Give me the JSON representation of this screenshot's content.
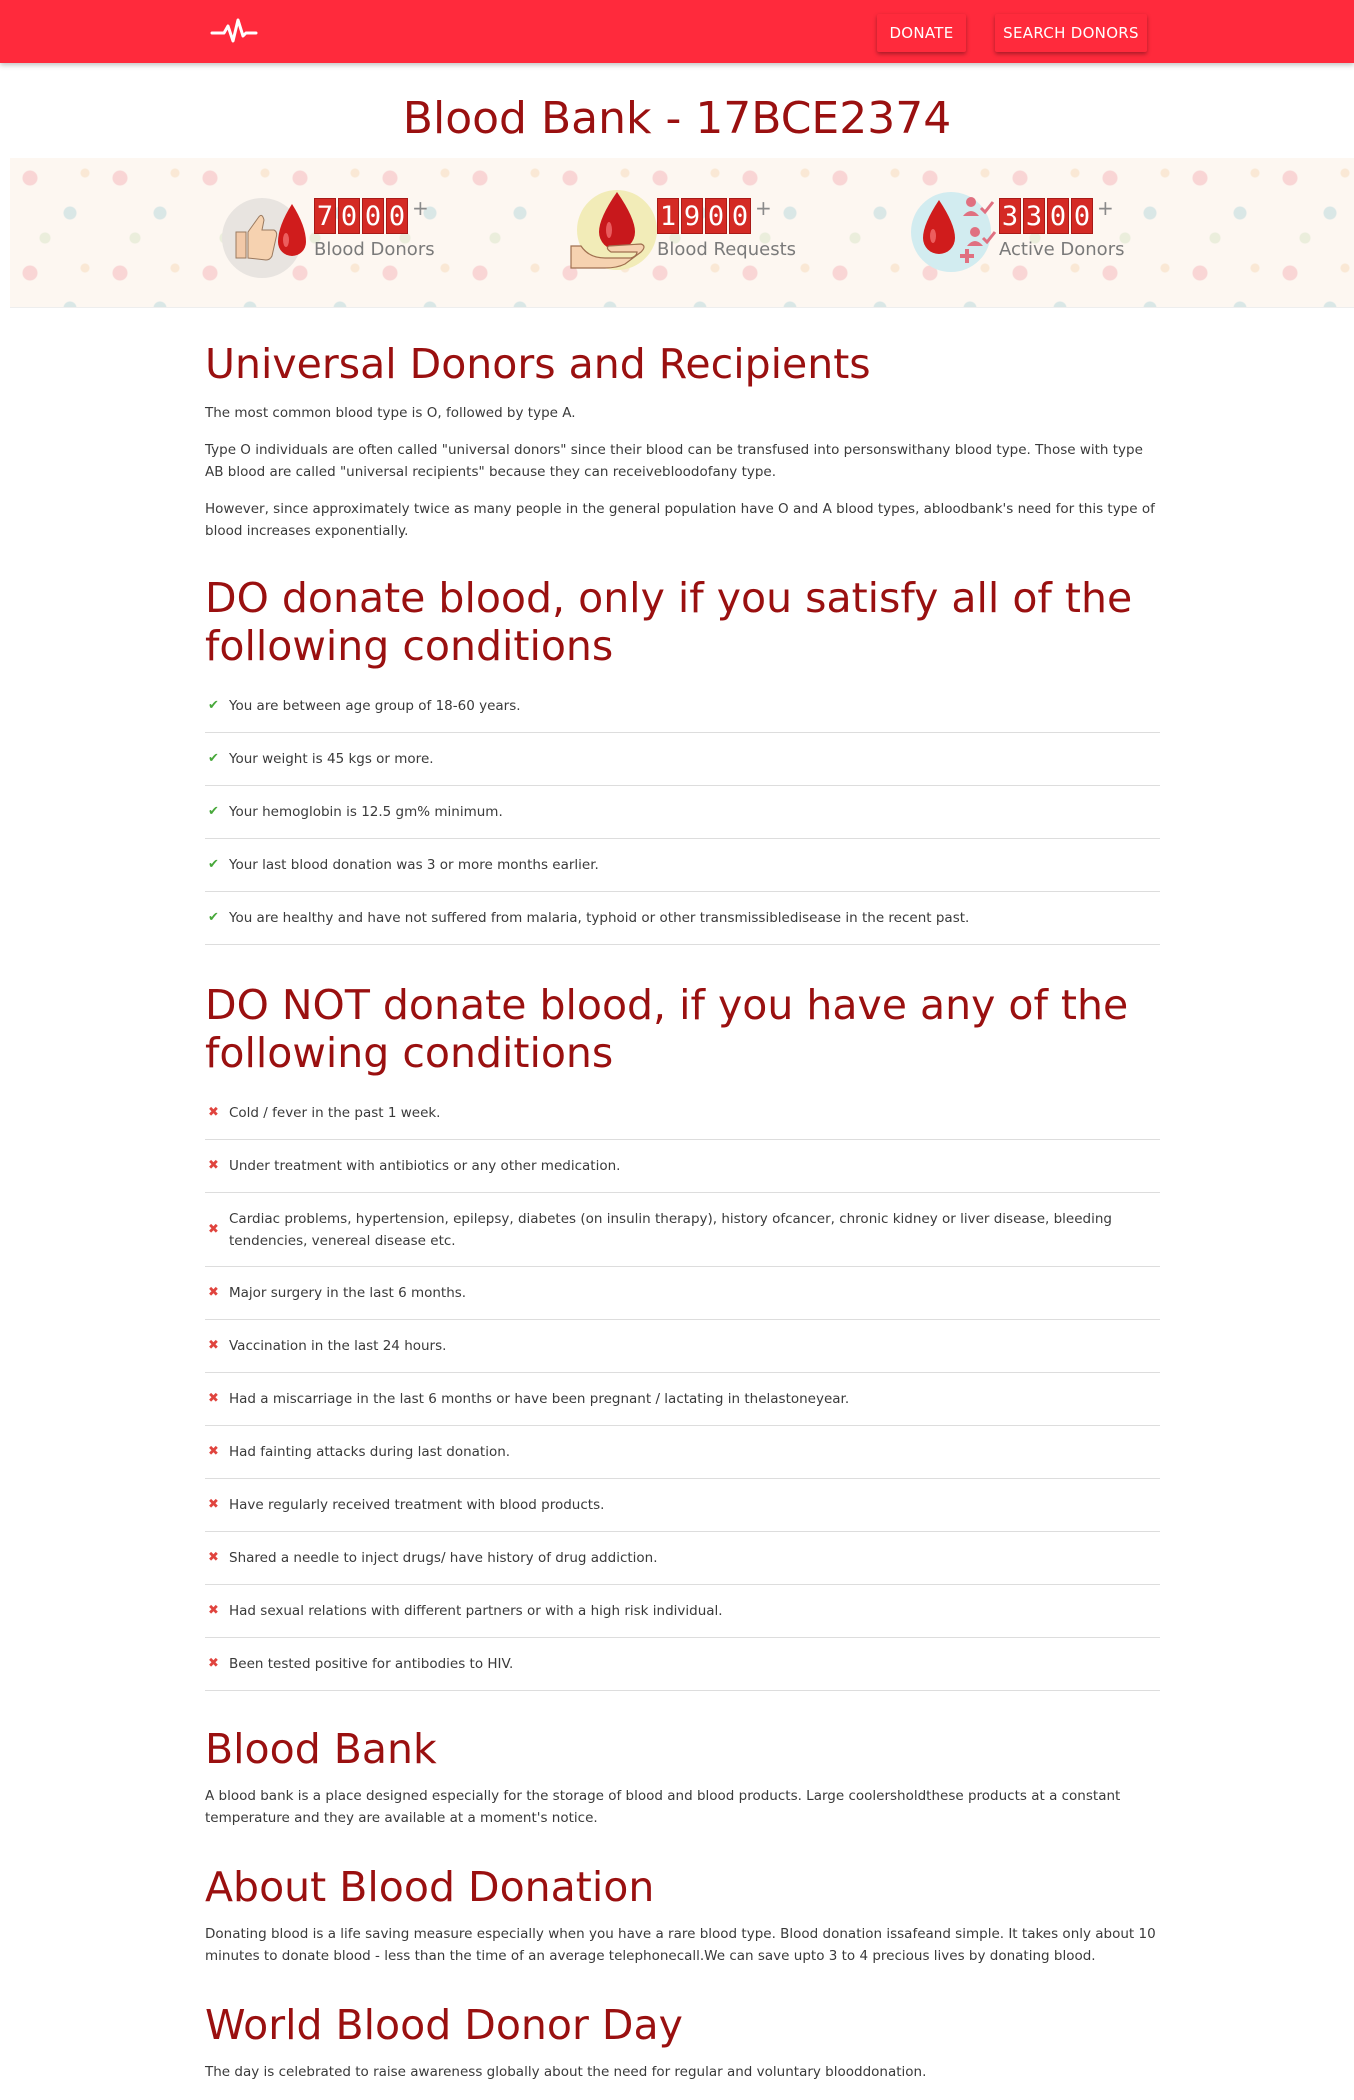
{
  "nav": {
    "donate_label": "DONATE",
    "search_label": "SEARCH DONORS"
  },
  "page_title": "Blood Bank - 17BCE2374",
  "stats": [
    {
      "digits": [
        "7",
        "0",
        "0",
        "0"
      ],
      "plus": "+",
      "label": "Blood Donors",
      "icon": "thumbs-up-blood-drop-icon"
    },
    {
      "digits": [
        "1",
        "9",
        "0",
        "0"
      ],
      "plus": "+",
      "label": "Blood Requests",
      "icon": "hand-holding-blood-drop-icon"
    },
    {
      "digits": [
        "3",
        "3",
        "0",
        "0"
      ],
      "plus": "+",
      "label": "Active Donors",
      "icon": "blood-drop-users-icon"
    }
  ],
  "universal": {
    "heading": "Universal Donors and Recipients",
    "p1": "The most common blood type is O, followed by type A.",
    "p2": "Type O individuals are often called \"universal donors\" since their blood can be transfused into personswithany blood type. Those with type AB blood are called \"universal recipients\" because they can receivebloodofany type.",
    "p3": "However, since approximately twice as many people in the general population have O and A blood types, abloodbank's need for this type of blood increases exponentially."
  },
  "do_donate": {
    "heading": "DO donate blood, only if you satisfy all of the following conditions",
    "items": [
      "You are between age group of 18-60 years.",
      "Your weight is 45 kgs or more.",
      "Your hemoglobin is 12.5 gm% minimum.",
      "Your last blood donation was 3 or more months earlier.",
      "You are healthy and have not suffered from malaria, typhoid or other transmissibledisease in the recent past."
    ]
  },
  "do_not_donate": {
    "heading": "DO NOT donate blood, if you have any of the following conditions",
    "items": [
      "Cold / fever in the past 1 week.",
      "Under treatment with antibiotics or any other medication.",
      "Cardiac problems, hypertension, epilepsy, diabetes (on insulin therapy), history ofcancer, chronic kidney or liver disease, bleeding tendencies, venereal disease etc.",
      "Major surgery in the last 6 months.",
      "Vaccination in the last 24 hours.",
      "Had a miscarriage in the last 6 months or have been pregnant / lactating in thelastoneyear.",
      "Had fainting attacks during last donation.",
      "Have regularly received treatment with blood products.",
      "Shared a needle to inject drugs/ have history of drug addiction.",
      "Had sexual relations with different partners or with a high risk individual.",
      "Been tested positive for antibodies to HIV."
    ]
  },
  "blood_bank": {
    "heading": "Blood Bank",
    "text": "A blood bank is a place designed especially for the storage of blood and blood products. Large coolersholdthese products at a constant temperature and they are available at a moment's notice."
  },
  "about": {
    "heading": "About Blood Donation",
    "text": "Donating blood is a life saving measure especially when you have a rare blood type. Blood donation issafeand simple. It takes only about 10 minutes to donate blood - less than the time of an average telephonecall.We can save upto 3 to 4 precious lives by donating blood."
  },
  "world_day": {
    "heading": "World Blood Donor Day",
    "text": "The day is celebrated to raise awareness globally about the need for regular and voluntary blooddonation."
  },
  "colors": {
    "brand_red": "#ff2a3c",
    "heading_red": "#9a1010",
    "check_green": "#47a83a",
    "cross_red": "#e0443e"
  }
}
